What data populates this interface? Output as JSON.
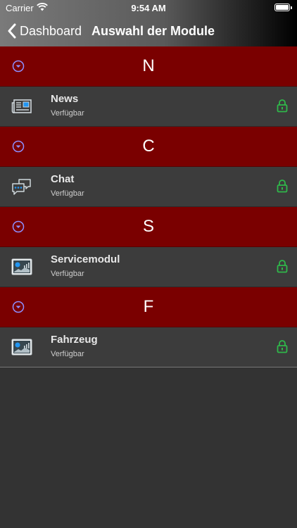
{
  "status": {
    "carrier": "Carrier",
    "time": "9:54 AM"
  },
  "nav": {
    "back_label": "Dashboard",
    "title": "Auswahl der Module"
  },
  "colors": {
    "section_bg": "#7a0000",
    "row_bg": "#3c3c3c",
    "lock": "#2fb84a",
    "toggle": "#8f8fff"
  },
  "sections": [
    {
      "letter": "N",
      "item": {
        "title": "News",
        "subtitle": "Verfügbar",
        "icon": "newspaper-icon"
      }
    },
    {
      "letter": "C",
      "item": {
        "title": "Chat",
        "subtitle": "Verfügbar",
        "icon": "chat-bubbles-icon"
      }
    },
    {
      "letter": "S",
      "item": {
        "title": "Servicemodul",
        "subtitle": "Verfügbar",
        "icon": "dashboard-chart-icon"
      }
    },
    {
      "letter": "F",
      "item": {
        "title": "Fahrzeug",
        "subtitle": "Verfügbar",
        "icon": "dashboard-chart-icon"
      }
    }
  ]
}
